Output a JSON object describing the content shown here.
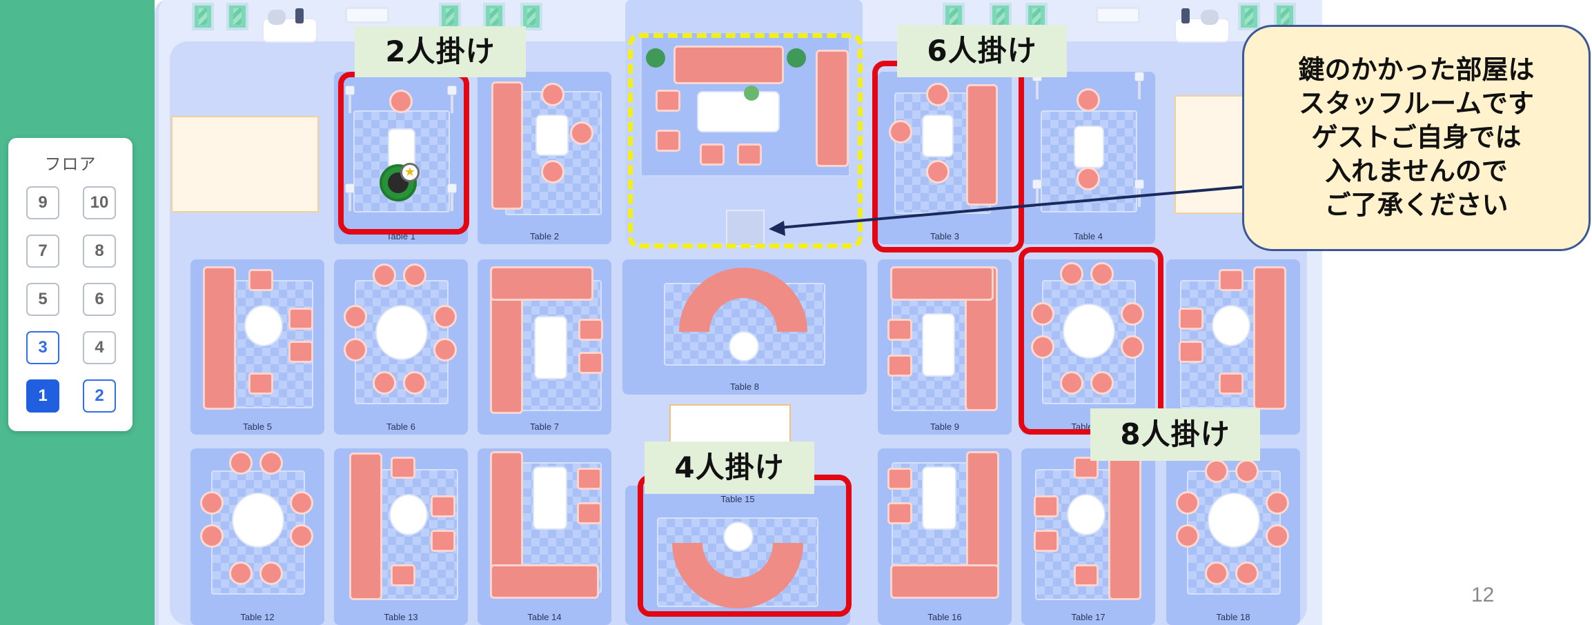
{
  "floor_selector": {
    "title": "フロア",
    "floors": [
      "9",
      "10",
      "7",
      "8",
      "5",
      "6",
      "3",
      "4",
      "1",
      "2"
    ],
    "selected_floor": "1",
    "highlighted_floors": [
      "3",
      "1",
      "2"
    ]
  },
  "tables": {
    "t1": "Table 1",
    "t2": "Table 2",
    "t3": "Table 3",
    "t4": "Table 4",
    "t5": "Table 5",
    "t6": "Table 6",
    "t7": "Table 7",
    "t8": "Table 8",
    "t9": "Table 9",
    "t10": "Table 10",
    "t12": "Table 12",
    "t13": "Table 13",
    "t14": "Table 14",
    "t15": "Table 15",
    "t16": "Table 16",
    "t17": "Table 17",
    "t18": "Table 18"
  },
  "annotations": {
    "two_seats": "2人掛け",
    "six_seats": "6人掛け",
    "four_seats": "4人掛け",
    "eight_seats": "8人掛け",
    "callout_lines": [
      "鍵のかかった部屋は",
      "スタッフルームです",
      "ゲストご自身では",
      "入れませんので",
      "ご了承ください"
    ]
  },
  "page_number": "12",
  "colors": {
    "green_band": "#4dba8f",
    "selected_floor": "#1f5fe0",
    "highlight_red": "#e30613",
    "highlight_yellow": "#f4ef1a",
    "callout_bg": "#fff2cc",
    "table_card": "#a5bef8",
    "sofa": "#f08c86"
  }
}
